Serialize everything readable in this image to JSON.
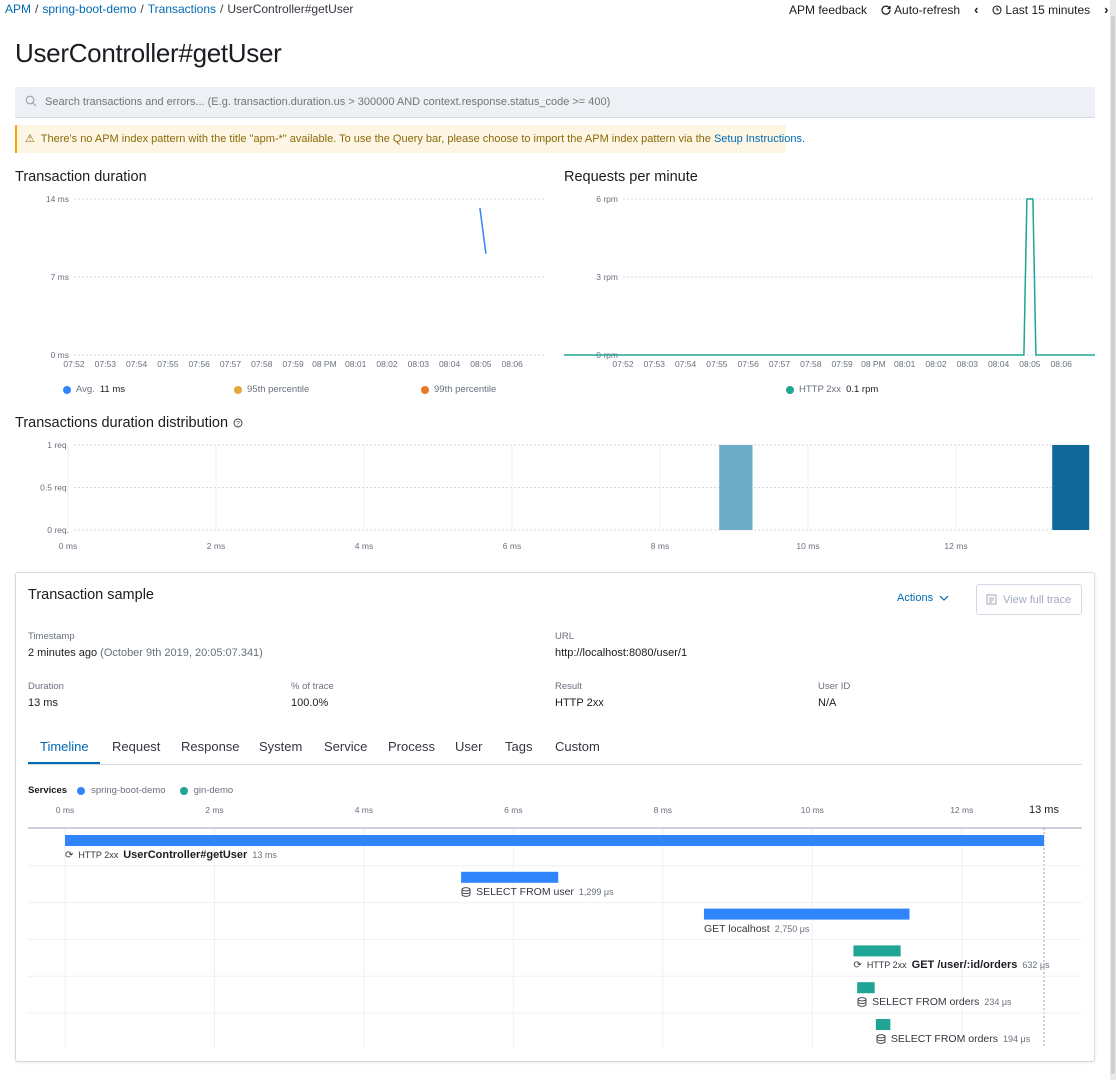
{
  "breadcrumb": [
    "APM",
    "spring-boot-demo",
    "Transactions",
    "UserController#getUser"
  ],
  "top_actions": {
    "feedback": "APM feedback",
    "refresh": "Auto-refresh",
    "time": "Last 15 minutes"
  },
  "title": "UserController#getUser",
  "search": {
    "placeholder": "Search transactions and errors... (E.g. transaction.duration.us > 300000 AND context.response.status_code >= 400)"
  },
  "warning": {
    "text": "There's no APM index pattern with the title \"apm-*\" available. To use the Query bar, please choose to import the APM index pattern via the",
    "link": "Setup Instructions."
  },
  "time_ticks": [
    "07:52",
    "07:53",
    "07:54",
    "07:55",
    "07:56",
    "07:57",
    "07:58",
    "07:59",
    "08 PM",
    "08:01",
    "08:02",
    "08:03",
    "08:04",
    "08:05",
    "08:06"
  ],
  "duration_chart": {
    "title": "Transaction duration",
    "y_ticks": [
      "14 ms",
      "7 ms",
      "0 ms"
    ],
    "legend": [
      {
        "name": "Avg.",
        "value": "11 ms",
        "color": "#3185fc"
      },
      {
        "name": "95th percentile",
        "value": "",
        "color": "#e6a83a"
      },
      {
        "name": "99th percentile",
        "value": "",
        "color": "#e7782a"
      }
    ]
  },
  "rpm_chart": {
    "title": "Requests per minute",
    "y_ticks": [
      "6 rpm",
      "3 rpm",
      "0 rpm"
    ],
    "legend": [
      {
        "name": "HTTP 2xx",
        "value": "0.1 rpm",
        "color": "#1ea593"
      }
    ]
  },
  "distribution": {
    "title": "Transactions duration distribution",
    "y_ticks": [
      "1 req.",
      "0.5 req.",
      "0 req."
    ],
    "x_ticks": [
      "0 ms",
      "2 ms",
      "4 ms",
      "6 ms",
      "8 ms",
      "10 ms",
      "12 ms"
    ],
    "colors": {
      "bar": "#6dadc7",
      "selected": "#0f6897"
    }
  },
  "chart_data": [
    {
      "type": "line",
      "title": "Transaction duration",
      "ylim": [
        0,
        14
      ],
      "x": [
        "07:52",
        "07:53",
        "07:54",
        "07:55",
        "07:56",
        "07:57",
        "07:58",
        "07:59",
        "08 PM",
        "08:01",
        "08:02",
        "08:03",
        "08:04",
        "08:05",
        "08:06"
      ],
      "series": [
        {
          "name": "Avg.",
          "points": [
            {
              "x": "08:05",
              "y": 13.2
            },
            {
              "x": "08:05",
              "y": 9.1
            }
          ]
        }
      ]
    },
    {
      "type": "line",
      "title": "Requests per minute",
      "ylim": [
        0,
        6
      ],
      "x": [
        "07:52",
        "07:53",
        "07:54",
        "07:55",
        "07:56",
        "07:57",
        "07:58",
        "07:59",
        "08 PM",
        "08:01",
        "08:02",
        "08:03",
        "08:04",
        "08:05",
        "08:06"
      ],
      "series": [
        {
          "name": "HTTP 2xx",
          "values": [
            0,
            0,
            0,
            0,
            0,
            0,
            0,
            0,
            0,
            0,
            0,
            0,
            0,
            6,
            0
          ]
        }
      ]
    },
    {
      "type": "bar",
      "title": "Transactions duration distribution",
      "xlabel": "",
      "ylabel": "",
      "ylim": [
        0,
        1
      ],
      "bins": [
        {
          "from_ms": 8.8,
          "to_ms": 9.25,
          "count": 1
        },
        {
          "from_ms": 13.3,
          "to_ms": 13.8,
          "count": 1,
          "selected": true
        }
      ]
    }
  ],
  "sample": {
    "title": "Transaction sample",
    "actions": "Actions",
    "view_trace": "View full trace",
    "timestamp_label": "Timestamp",
    "timestamp_value": "2 minutes ago",
    "timestamp_detail": "(October 9th 2019, 20:05:07.341)",
    "url_label": "URL",
    "url_value": "http://localhost:8080/user/1",
    "duration_label": "Duration",
    "duration_value": "13 ms",
    "trace_label": "% of trace",
    "trace_value": "100.0%",
    "result_label": "Result",
    "result_value": "HTTP 2xx",
    "userid_label": "User ID",
    "userid_value": "N/A"
  },
  "tabs": [
    "Timeline",
    "Request",
    "Response",
    "System",
    "Service",
    "Process",
    "User",
    "Tags",
    "Custom"
  ],
  "timeline": {
    "services_label": "Services",
    "services": [
      {
        "name": "spring-boot-demo",
        "color": "#3185fc"
      },
      {
        "name": "gin-demo",
        "color": "#1ea593"
      }
    ],
    "ticks": [
      "0 ms",
      "2 ms",
      "4 ms",
      "6 ms",
      "8 ms",
      "10 ms",
      "12 ms"
    ],
    "end_label": "13 ms",
    "total_ms": 13.1,
    "spans": [
      {
        "status": "HTTP 2xx",
        "name": "UserController#getUser",
        "duration": "13 ms",
        "start_ms": 0,
        "dur_ms": 13.1,
        "service": 0,
        "kind": "transaction"
      },
      {
        "status": "",
        "name": "SELECT FROM user",
        "duration": "1,299 μs",
        "start_ms": 5.3,
        "dur_ms": 1.3,
        "service": 0,
        "kind": "db"
      },
      {
        "status": "",
        "name": "GET localhost",
        "duration": "2,750 μs",
        "start_ms": 8.55,
        "dur_ms": 2.75,
        "service": 0,
        "kind": "http"
      },
      {
        "status": "HTTP 2xx",
        "name": "GET /user/:id/orders",
        "duration": "632 μs",
        "start_ms": 10.55,
        "dur_ms": 0.632,
        "service": 1,
        "kind": "transaction"
      },
      {
        "status": "",
        "name": "SELECT FROM orders",
        "duration": "234 μs",
        "start_ms": 10.6,
        "dur_ms": 0.234,
        "service": 1,
        "kind": "db"
      },
      {
        "status": "",
        "name": "SELECT FROM orders",
        "duration": "194 μs",
        "start_ms": 10.85,
        "dur_ms": 0.194,
        "service": 1,
        "kind": "db"
      }
    ]
  }
}
